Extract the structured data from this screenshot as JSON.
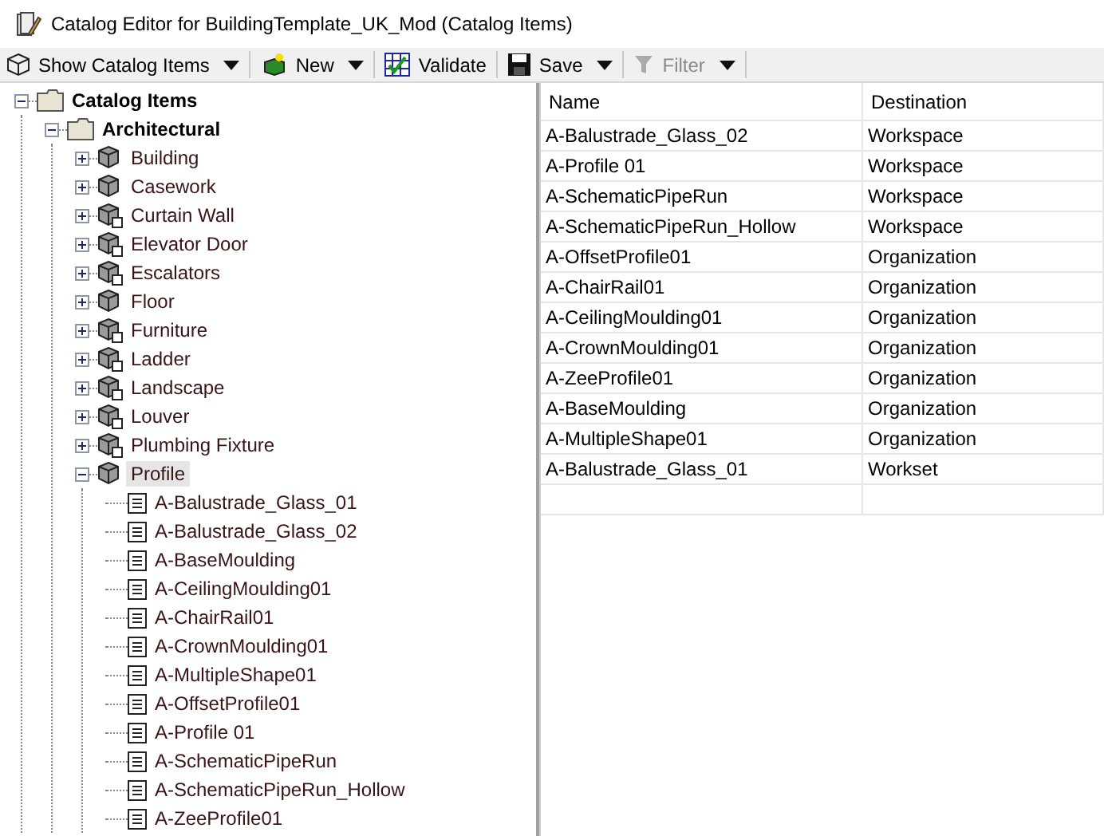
{
  "window": {
    "title": "Catalog Editor for BuildingTemplate_UK_Mod (Catalog Items)"
  },
  "toolbar": [
    {
      "kind": "view",
      "label": "Show Catalog Items",
      "dropdown": true,
      "disabled": false
    },
    {
      "kind": "new",
      "label": "New",
      "dropdown": true,
      "disabled": false
    },
    {
      "kind": "validate",
      "label": "Validate",
      "dropdown": false,
      "disabled": false
    },
    {
      "kind": "save",
      "label": "Save",
      "dropdown": true,
      "disabled": false
    },
    {
      "kind": "filter",
      "label": "Filter",
      "dropdown": true,
      "disabled": true
    }
  ],
  "tree": [
    {
      "kind": "folder",
      "label": "Catalog Items",
      "bold": true,
      "expanded": true,
      "selected": false,
      "children": [
        {
          "kind": "folder",
          "label": "Architectural",
          "bold": true,
          "expanded": true,
          "selected": false,
          "children": [
            {
              "kind": "category",
              "label": "Building",
              "locked": false,
              "expanded": false,
              "selected": false
            },
            {
              "kind": "category",
              "label": "Casework",
              "locked": false,
              "expanded": false,
              "selected": false
            },
            {
              "kind": "category",
              "label": "Curtain Wall",
              "locked": true,
              "expanded": false,
              "selected": false
            },
            {
              "kind": "category",
              "label": "Elevator Door",
              "locked": true,
              "expanded": false,
              "selected": false
            },
            {
              "kind": "category",
              "label": "Escalators",
              "locked": true,
              "expanded": false,
              "selected": false
            },
            {
              "kind": "category",
              "label": "Floor",
              "locked": false,
              "expanded": false,
              "selected": false
            },
            {
              "kind": "category",
              "label": "Furniture",
              "locked": true,
              "expanded": false,
              "selected": false
            },
            {
              "kind": "category",
              "label": "Ladder",
              "locked": true,
              "expanded": false,
              "selected": false
            },
            {
              "kind": "category",
              "label": "Landscape",
              "locked": true,
              "expanded": false,
              "selected": false
            },
            {
              "kind": "category",
              "label": "Louver",
              "locked": true,
              "expanded": false,
              "selected": false
            },
            {
              "kind": "category",
              "label": "Plumbing Fixture",
              "locked": true,
              "expanded": false,
              "selected": false
            },
            {
              "kind": "category",
              "label": "Profile",
              "locked": false,
              "expanded": true,
              "selected": true,
              "children": [
                {
                  "kind": "item",
                  "label": "A-Balustrade_Glass_01",
                  "selected": false
                },
                {
                  "kind": "item",
                  "label": "A-Balustrade_Glass_02",
                  "selected": false
                },
                {
                  "kind": "item",
                  "label": "A-BaseMoulding",
                  "selected": false
                },
                {
                  "kind": "item",
                  "label": "A-CeilingMoulding01",
                  "selected": false
                },
                {
                  "kind": "item",
                  "label": "A-ChairRail01",
                  "selected": false
                },
                {
                  "kind": "item",
                  "label": "A-CrownMoulding01",
                  "selected": false
                },
                {
                  "kind": "item",
                  "label": "A-MultipleShape01",
                  "selected": false
                },
                {
                  "kind": "item",
                  "label": "A-OffsetProfile01",
                  "selected": false
                },
                {
                  "kind": "item",
                  "label": "A-Profile 01",
                  "selected": false
                },
                {
                  "kind": "item",
                  "label": "A-SchematicPipeRun",
                  "selected": false
                },
                {
                  "kind": "item",
                  "label": "A-SchematicPipeRun_Hollow",
                  "selected": false
                },
                {
                  "kind": "item",
                  "label": "A-ZeeProfile01",
                  "selected": false
                }
              ]
            }
          ]
        }
      ]
    }
  ],
  "table": {
    "columns": [
      "Name",
      "Destination"
    ],
    "rows": [
      [
        "A-Balustrade_Glass_02",
        "Workspace"
      ],
      [
        "A-Profile 01",
        "Workspace"
      ],
      [
        "A-SchematicPipeRun",
        "Workspace"
      ],
      [
        "A-SchematicPipeRun_Hollow",
        "Workspace"
      ],
      [
        "A-OffsetProfile01",
        "Organization"
      ],
      [
        "A-ChairRail01",
        "Organization"
      ],
      [
        "A-CeilingMoulding01",
        "Organization"
      ],
      [
        "A-CrownMoulding01",
        "Organization"
      ],
      [
        "A-ZeeProfile01",
        "Organization"
      ],
      [
        "A-BaseMoulding",
        "Organization"
      ],
      [
        "A-MultipleShape01",
        "Organization"
      ],
      [
        "A-Balustrade_Glass_01",
        "Workset"
      ]
    ]
  }
}
